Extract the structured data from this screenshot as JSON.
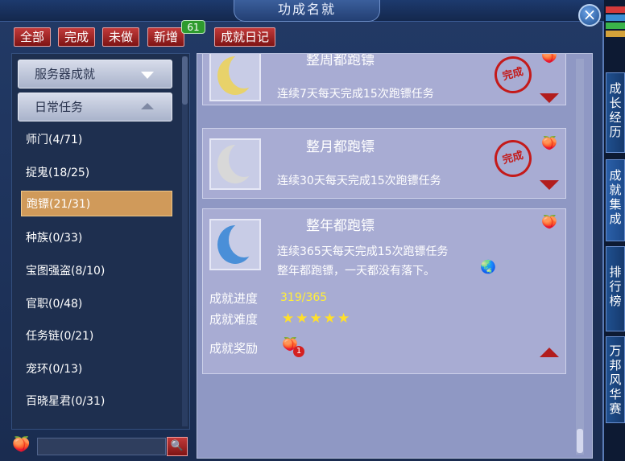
{
  "window": {
    "title": "功成名就",
    "close_icon": "×"
  },
  "toolbar": {
    "tabs": [
      {
        "label": "全部"
      },
      {
        "label": "完成"
      },
      {
        "label": "未做"
      },
      {
        "label": "新增"
      },
      {
        "label": "成就日记"
      }
    ],
    "new_badge": "61"
  },
  "sidebar": {
    "dropdowns": [
      {
        "label": "服务器成就"
      },
      {
        "label": "日常任务"
      }
    ],
    "categories": [
      {
        "label": "师门(4/71)"
      },
      {
        "label": "捉鬼(18/25)"
      },
      {
        "label": "跑镖(21/31)",
        "selected": true
      },
      {
        "label": "种族(0/33)"
      },
      {
        "label": "宝图强盗(8/10)"
      },
      {
        "label": "官职(0/48)"
      },
      {
        "label": "任务链(0/21)"
      },
      {
        "label": "宠环(0/13)"
      },
      {
        "label": "百晓星君(0/31)"
      }
    ],
    "search_placeholder": ""
  },
  "achievements": [
    {
      "name": "整周都跑镖",
      "desc": "连续7天每天完成15次跑镖任务",
      "seal": "完成",
      "moon": "gold"
    },
    {
      "name": "整月都跑镖",
      "desc": "连续30天每天完成15次跑镖任务",
      "seal": "完成",
      "moon": "silver"
    },
    {
      "name": "整年都跑镖",
      "desc": "连续365天每天完成15次跑镖任务",
      "flavor": "整年都跑镖，一天都没有落下。",
      "moon": "blue",
      "labels": {
        "progress": "成就进度",
        "difficulty": "成就难度",
        "reward": "成就奖励"
      },
      "progress": "319/365",
      "difficulty_stars": "★★★★★",
      "reward_count": "1"
    }
  ],
  "side_tabs": [
    {
      "label": "成长经历"
    },
    {
      "label": "成就集成"
    },
    {
      "label": "排行榜"
    },
    {
      "label": "万邦风华赛"
    }
  ],
  "colors": {
    "accent_red": "#b21d1d",
    "selected_item": "#d09a5a",
    "progress_yellow": "#ffee3a"
  }
}
